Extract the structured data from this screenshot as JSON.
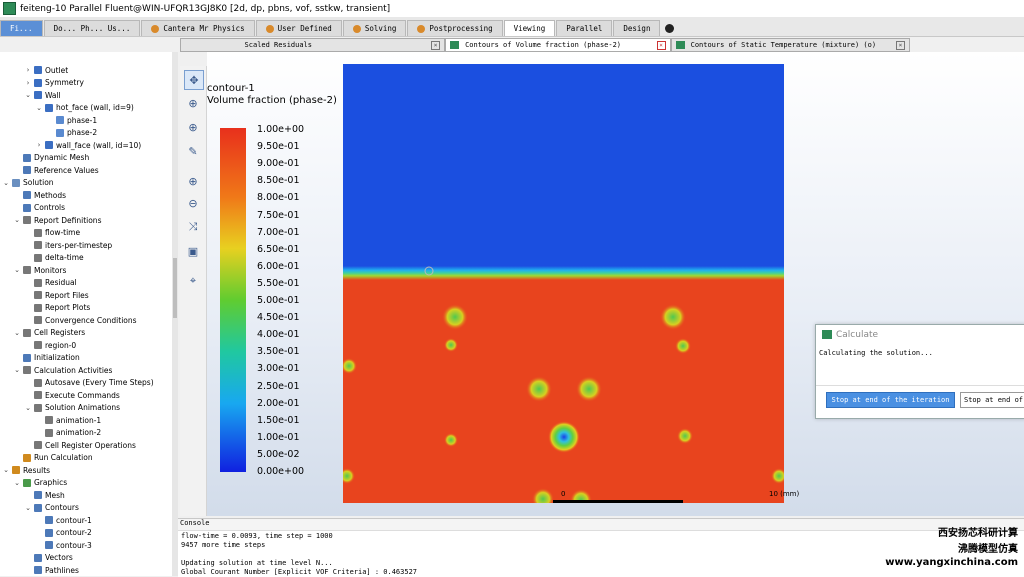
{
  "window": {
    "title": "feiteng-10 Parallel Fluent@WIN-UFQR13GJ8K0 [2d, dp, pbns, vof, sstkw, transient]"
  },
  "menu_tabs": [
    {
      "label": "Fi...",
      "state": "first"
    },
    {
      "label": "Do...  Ph...  Us...",
      "state": "normal"
    },
    {
      "label": "Cantera Mr Physics",
      "state": "normal"
    },
    {
      "label": "User Defined",
      "state": "normal"
    },
    {
      "label": "Solving",
      "state": "normal"
    },
    {
      "label": "Postprocessing",
      "state": "normal"
    },
    {
      "label": "Viewing",
      "state": "active"
    },
    {
      "label": "Parallel",
      "state": "normal"
    },
    {
      "label": "Design",
      "state": "normal"
    }
  ],
  "graphics_tabs": [
    {
      "label": "Scaled Residuals",
      "active": false
    },
    {
      "label": "Contours of Volume fraction (phase-2)",
      "active": true
    },
    {
      "label": "Contours of Static Temperature (mixture)  (o)",
      "active": false
    }
  ],
  "tree": [
    {
      "label": "Outlet",
      "indent": 2,
      "tw": ">",
      "color": "#3b6ec2"
    },
    {
      "label": "Symmetry",
      "indent": 2,
      "tw": ">",
      "color": "#3b6ec2"
    },
    {
      "label": "Wall",
      "indent": 2,
      "tw": "v",
      "color": "#3b6ec2"
    },
    {
      "label": "hot_face (wall, id=9)",
      "indent": 3,
      "tw": "v",
      "color": "#3b6ec2"
    },
    {
      "label": "phase-1",
      "indent": 4,
      "tw": "",
      "color": "#5a8ad0"
    },
    {
      "label": "phase-2",
      "indent": 4,
      "tw": "",
      "color": "#5a8ad0"
    },
    {
      "label": "wall_face (wall, id=10)",
      "indent": 3,
      "tw": ">",
      "color": "#3b6ec2"
    },
    {
      "label": "Dynamic Mesh",
      "indent": 1,
      "tw": "",
      "color": "#4d79b8"
    },
    {
      "label": "Reference Values",
      "indent": 1,
      "tw": "",
      "color": "#4d79b8"
    },
    {
      "label": "Solution",
      "indent": 0,
      "tw": "v",
      "color": "#6a8fc0"
    },
    {
      "label": "Methods",
      "indent": 1,
      "tw": "",
      "color": "#4d79b8"
    },
    {
      "label": "Controls",
      "indent": 1,
      "tw": "",
      "color": "#4d79b8"
    },
    {
      "label": "Report Definitions",
      "indent": 1,
      "tw": "v",
      "color": "#777"
    },
    {
      "label": "flow-time",
      "indent": 2,
      "tw": "",
      "color": "#777"
    },
    {
      "label": "iters-per-timestep",
      "indent": 2,
      "tw": "",
      "color": "#777"
    },
    {
      "label": "delta-time",
      "indent": 2,
      "tw": "",
      "color": "#777"
    },
    {
      "label": "Monitors",
      "indent": 1,
      "tw": "v",
      "color": "#777"
    },
    {
      "label": "Residual",
      "indent": 2,
      "tw": "",
      "color": "#777"
    },
    {
      "label": "Report Files",
      "indent": 2,
      "tw": "",
      "color": "#777"
    },
    {
      "label": "Report Plots",
      "indent": 2,
      "tw": "",
      "color": "#777"
    },
    {
      "label": "Convergence Conditions",
      "indent": 2,
      "tw": "",
      "color": "#777"
    },
    {
      "label": "Cell Registers",
      "indent": 1,
      "tw": "v",
      "color": "#777"
    },
    {
      "label": "region-0",
      "indent": 2,
      "tw": "",
      "color": "#777"
    },
    {
      "label": "Initialization",
      "indent": 1,
      "tw": "",
      "color": "#4d79b8"
    },
    {
      "label": "Calculation Activities",
      "indent": 1,
      "tw": "v",
      "color": "#777"
    },
    {
      "label": "Autosave (Every Time Steps)",
      "indent": 2,
      "tw": "",
      "color": "#777"
    },
    {
      "label": "Execute Commands",
      "indent": 2,
      "tw": "",
      "color": "#777"
    },
    {
      "label": "Solution Animations",
      "indent": 2,
      "tw": "v",
      "color": "#777"
    },
    {
      "label": "animation-1",
      "indent": 3,
      "tw": "",
      "color": "#777"
    },
    {
      "label": "animation-2",
      "indent": 3,
      "tw": "",
      "color": "#777"
    },
    {
      "label": "Cell Register Operations",
      "indent": 2,
      "tw": "",
      "color": "#777"
    },
    {
      "label": "Run Calculation",
      "indent": 1,
      "tw": "",
      "color": "#d08a1e"
    },
    {
      "label": "Results",
      "indent": 0,
      "tw": "v",
      "color": "#d08a1e"
    },
    {
      "label": "Graphics",
      "indent": 1,
      "tw": "v",
      "color": "#4a9a4a"
    },
    {
      "label": "Mesh",
      "indent": 2,
      "tw": "",
      "color": "#4d79b8"
    },
    {
      "label": "Contours",
      "indent": 2,
      "tw": "v",
      "color": "#4d79b8"
    },
    {
      "label": "contour-1",
      "indent": 3,
      "tw": "",
      "color": "#4d79b8"
    },
    {
      "label": "contour-2",
      "indent": 3,
      "tw": "",
      "color": "#4d79b8"
    },
    {
      "label": "contour-3",
      "indent": 3,
      "tw": "",
      "color": "#4d79b8"
    },
    {
      "label": "Vectors",
      "indent": 2,
      "tw": "",
      "color": "#4d79b8"
    },
    {
      "label": "Pathlines",
      "indent": 2,
      "tw": "",
      "color": "#4d79b8"
    }
  ],
  "toolbar": [
    {
      "icon": "move-icon",
      "glyph": "✥"
    },
    {
      "icon": "zoom-fit-icon",
      "glyph": "⊕"
    },
    {
      "icon": "zoom-in-icon",
      "glyph": "⊕"
    },
    {
      "icon": "probe-icon",
      "glyph": "✎"
    },
    {
      "icon": "zoom-box-icon",
      "glyph": "⊕"
    },
    {
      "icon": "zoom-out-icon",
      "glyph": "⊖"
    },
    {
      "icon": "pan-icon",
      "glyph": "⤨"
    },
    {
      "icon": "fit-screen-icon",
      "glyph": "▣"
    },
    {
      "icon": "view-options-icon",
      "glyph": "⌖"
    }
  ],
  "contour": {
    "name": "contour-1",
    "variable": "Volume fraction (phase-2)",
    "scale_labels": [
      "1.00e+00",
      "9.50e-01",
      "9.00e-01",
      "8.50e-01",
      "8.00e-01",
      "7.50e-01",
      "7.00e-01",
      "6.50e-01",
      "6.00e-01",
      "5.50e-01",
      "5.00e-01",
      "4.50e-01",
      "4.00e-01",
      "3.50e-01",
      "3.00e-01",
      "2.50e-01",
      "2.00e-01",
      "1.50e-01",
      "1.00e-01",
      "5.00e-02",
      "0.00e+00"
    ],
    "interface_level": 0.46,
    "ruler": {
      "start": "0",
      "end": "10 (mm)"
    }
  },
  "calculate_dialog": {
    "title": "Calculate",
    "message": "Calculating the solution...",
    "stop_iteration": "Stop at end of the iteration",
    "stop_timestep": "Stop at end of"
  },
  "console": {
    "title": "Console",
    "lines": [
      "flow-time = 0.0093, time step = 1000",
      "9457 more time steps",
      "",
      "Updating solution at time level N...",
      "Global Courant Number [Explicit VOF Criteria] : 0.463527"
    ]
  },
  "watermark": {
    "line1": "西安扬芯科研计算",
    "line2": "沸腾模型仿真",
    "line3": "www.yangxinchina.com"
  },
  "colors": {
    "liquid": "#e8441e",
    "gas": "#1b4fe0",
    "ui_blue": "#4a90e2"
  }
}
